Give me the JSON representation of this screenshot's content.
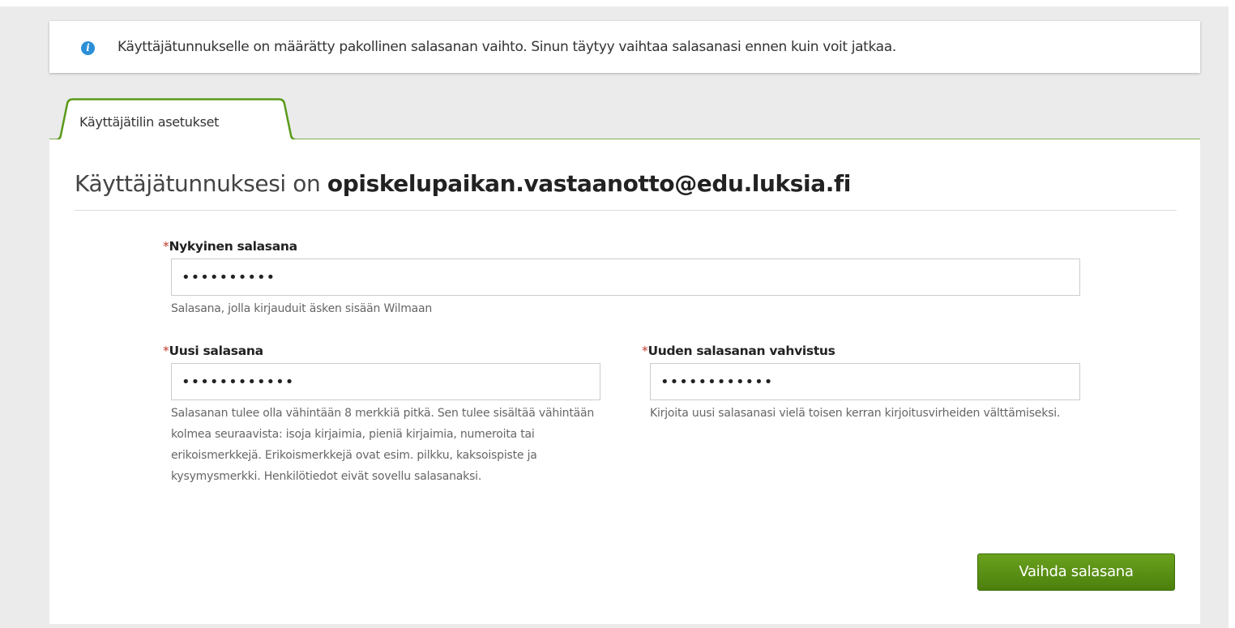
{
  "info_banner": {
    "icon": "info-icon",
    "text": "Käyttäjätunnukselle on määrätty pakollinen salasanan vaihto. Sinun täytyy vaihtaa salasanasi ennen kuin voit jatkaa."
  },
  "tabs": [
    {
      "label": "Käyttäjätilin asetukset",
      "active": true
    }
  ],
  "page": {
    "title_prefix": "Käyttäjätunnuksesi on ",
    "username": "opiskelupaikan.vastaanotto@edu.luksia.fi"
  },
  "form": {
    "required_marker": "*",
    "current_password": {
      "label": "Nykyinen salasana",
      "value": "••••••••••",
      "help": "Salasana, jolla kirjauduit äsken sisään Wilmaan"
    },
    "new_password": {
      "label": "Uusi salasana",
      "value": "••••••••••••",
      "help": "Salasanan tulee olla vähintään 8 merkkiä pitkä. Sen tulee sisältää vähintään kolmea seuraavista: isoja kirjaimia, pieniä kirjaimia, numeroita tai erikoismerkkejä. Erikoismerkkejä ovat esim. pilkku, kaksoispiste ja kysymysmerkki. Henkilötiedot eivät sovellu salasanaksi."
    },
    "confirm_password": {
      "label": "Uuden salasanan vahvistus",
      "value": "••••••••••••",
      "help": "Kirjoita uusi salasanasi vielä toisen kerran kirjoitusvirheiden välttämiseksi."
    },
    "submit_label": "Vaihda salasana"
  },
  "colors": {
    "accent_green": "#5a9a1a",
    "info_blue": "#2b8fd6",
    "required_red": "#c0392b"
  }
}
